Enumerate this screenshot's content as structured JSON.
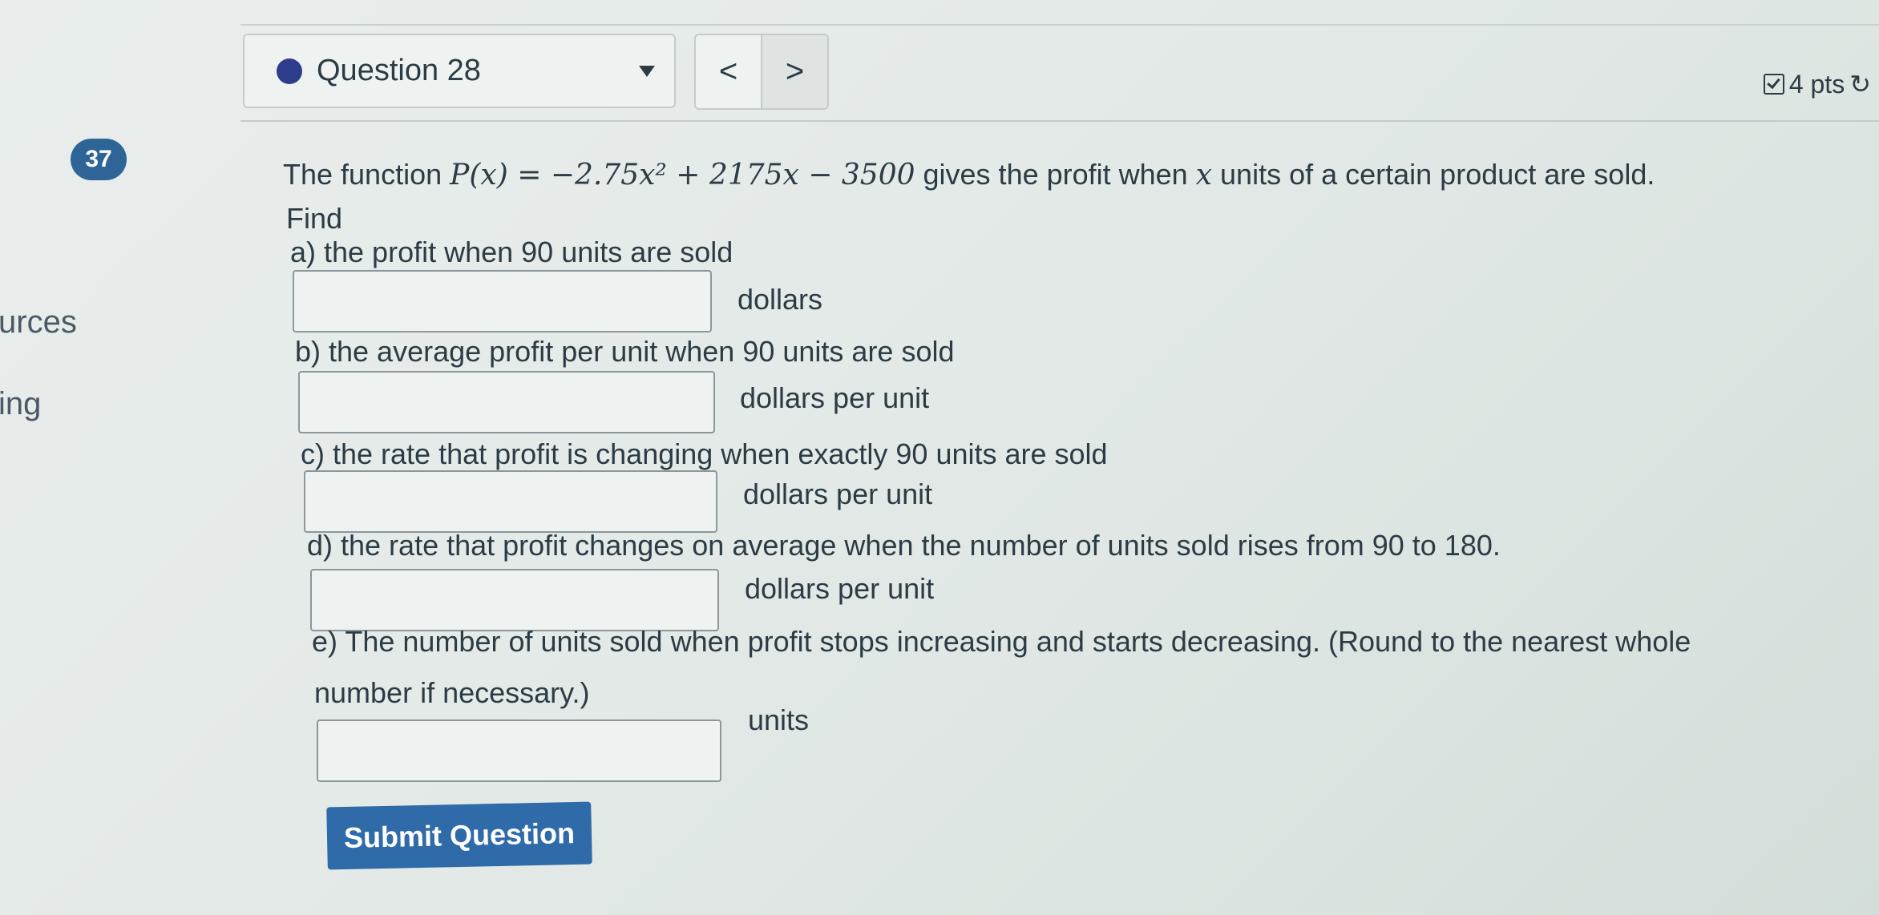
{
  "sidebar": {
    "badge": "37",
    "items": [
      "urces",
      "ing"
    ]
  },
  "header": {
    "question_label": "Question 28",
    "prev": "<",
    "next": ">",
    "points": "4 pts",
    "refresh_icon": "↻"
  },
  "question": {
    "intro": "The function",
    "function_lhs": "P(x) = ",
    "function_rhs": "−2.75x² + 2175x − 3500",
    "intro_tail_1": " gives the profit when ",
    "var_x": "x",
    "intro_tail_2": " units of a certain product are sold.",
    "find": "Find",
    "parts": [
      {
        "label": "a) the profit when 90 units are sold",
        "unit": "dollars"
      },
      {
        "label": "b) the average profit per unit when 90 units are sold",
        "unit": "dollars per unit"
      },
      {
        "label": "c) the rate that profit is changing when exactly 90 units are sold",
        "unit": "dollars per unit"
      },
      {
        "label": "d) the rate that profit changes on average when the number of units sold rises from 90 to 180.",
        "unit": "dollars per unit"
      },
      {
        "label": "e) The number of units sold when profit stops increasing and starts decreasing. (Round to the nearest whole",
        "label2": "number if necessary.)",
        "unit": "units"
      }
    ]
  },
  "submit_label": "Submit Question"
}
